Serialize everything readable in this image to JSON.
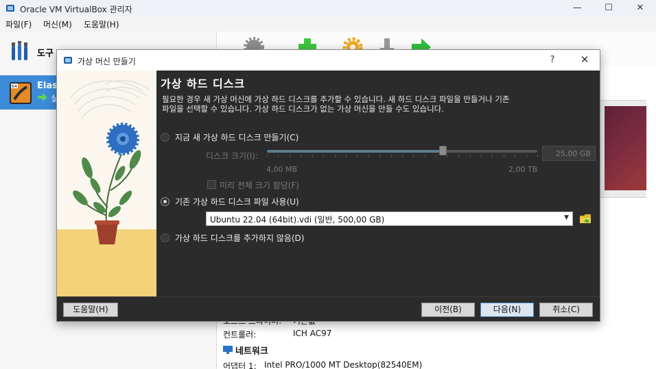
{
  "window": {
    "title": "Oracle VM VirtualBox 관리자",
    "minimize": "—",
    "maximize": "☐",
    "close": "✕"
  },
  "menu": [
    "파일(F)",
    "머신(M)",
    "도움말(H)"
  ],
  "sidebar": {
    "tools_label": "도구",
    "vm_name": "Elas",
    "vm_state": "실"
  },
  "details": {
    "audio_host_driver_label": "호스트 드라이버:",
    "audio_host_driver_value": "기본값",
    "controller_label": "컨트롤러:",
    "controller_value": "ICH AC97",
    "network_heading": "네트워크",
    "adapter_label": "어댑터 1:",
    "adapter_value": "Intel PRO/1000 MT Desktop(82540EM)"
  },
  "dialog": {
    "title": "가상 머신 만들기",
    "help": "?",
    "close": "✕",
    "page_title": "가상 하드 디스크",
    "description": "필요한 경우 새 가상 머신에 가상 하드 디스크를 추가할 수 있습니다. 새 하드 디스크 파일을 만들거나 기존 파일을 선택할 수 있습니다. 가상 하드 디스크가 없는 가상 머신을 만들 수도 있습니다.",
    "options": {
      "create_new": "지금 새 가상 하드 디스크 만들기(C)",
      "disk_size_label": "디스크 크기(I):",
      "disk_size_value": "25,00 GB",
      "size_min": "4,00 MB",
      "size_max": "2,00 TB",
      "disk_size_fraction": 0.65,
      "preallocate": "미리 전체 크기 할당(F)",
      "use_existing": "기존 가상 하드 디스크 파일 사용(U)",
      "existing_file": "Ubuntu 22.04 (64bit).vdi (일반, 500,00 GB)",
      "no_disk": "가상 하드 디스크를 추가하지 않음(D)",
      "selected": "use_existing"
    },
    "buttons": {
      "help": "도움말(H)",
      "back": "이전(B)",
      "next": "다음(N)",
      "cancel": "취소(C)"
    }
  },
  "colors": {
    "accent": "#3b8bd8",
    "dialog_body": "#2b2b2b",
    "flower": "#2e6fc2"
  }
}
